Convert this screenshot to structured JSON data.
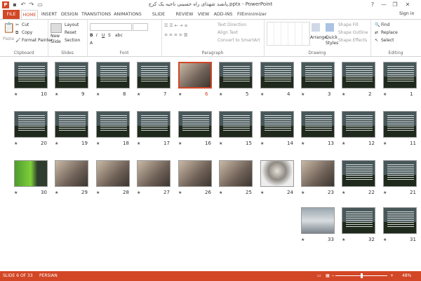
{
  "titlebar": {
    "title": "پانصد شهدای راه حسینی ناحیه یک کرج.pptx - PowerPoint",
    "app_icon": "P",
    "help": "?",
    "minimize": "—",
    "restore": "❐",
    "close": "✕"
  },
  "tabs": [
    "FILE",
    "HOME",
    "INSERT",
    "DESIGN",
    "TRANSITIONS",
    "ANIMATIONS",
    "SLIDE SHOW",
    "REVIEW",
    "VIEW",
    "ADD-INS",
    "FilEminimizer"
  ],
  "signin": "Sign in",
  "ribbon": {
    "clipboard": {
      "label": "Clipboard",
      "paste": "Paste",
      "cut": "Cut",
      "copy": "Copy",
      "format_painter": "Format Painter"
    },
    "slides": {
      "label": "Slides",
      "new_slide": "New",
      "new_slide2": "Slide",
      "layout": "Layout",
      "reset": "Reset",
      "section": "Section"
    },
    "font": {
      "label": "Font"
    },
    "paragraph": {
      "label": "Paragraph",
      "text_direction": "Text Direction",
      "align_text": "Align Text",
      "convert": "Convert to SmartArt"
    },
    "drawing": {
      "label": "Drawing",
      "arrange": "Arrange",
      "quick_styles": "Quick",
      "quick_styles2": "Styles",
      "shape_fill": "Shape Fill",
      "shape_outline": "Shape Outline",
      "shape_effects": "Shape Effects"
    },
    "editing": {
      "label": "Editing",
      "find": "Find",
      "replace": "Replace",
      "select": "Select"
    }
  },
  "slides": [
    {
      "n": "1",
      "kind": "text"
    },
    {
      "n": "2",
      "kind": "text"
    },
    {
      "n": "3",
      "kind": "text"
    },
    {
      "n": "4",
      "kind": "text"
    },
    {
      "n": "5",
      "kind": "text"
    },
    {
      "n": "6",
      "kind": "photo",
      "selected": true
    },
    {
      "n": "7",
      "kind": "text"
    },
    {
      "n": "8",
      "kind": "text"
    },
    {
      "n": "9",
      "kind": "text"
    },
    {
      "n": "10",
      "kind": "text"
    },
    {
      "n": "11",
      "kind": "text"
    },
    {
      "n": "12",
      "kind": "text"
    },
    {
      "n": "13",
      "kind": "text"
    },
    {
      "n": "14",
      "kind": "text"
    },
    {
      "n": "15",
      "kind": "text"
    },
    {
      "n": "16",
      "kind": "text"
    },
    {
      "n": "17",
      "kind": "text"
    },
    {
      "n": "18",
      "kind": "text"
    },
    {
      "n": "19",
      "kind": "text"
    },
    {
      "n": "20",
      "kind": "text"
    },
    {
      "n": "21",
      "kind": "text"
    },
    {
      "n": "22",
      "kind": "text"
    },
    {
      "n": "23",
      "kind": "photo"
    },
    {
      "n": "24",
      "kind": "portrait"
    },
    {
      "n": "25",
      "kind": "photo"
    },
    {
      "n": "26",
      "kind": "photo"
    },
    {
      "n": "27",
      "kind": "photo"
    },
    {
      "n": "28",
      "kind": "photo"
    },
    {
      "n": "29",
      "kind": "photo"
    },
    {
      "n": "30",
      "kind": "green"
    },
    {
      "n": "31",
      "kind": "text"
    },
    {
      "n": "32",
      "kind": "text"
    },
    {
      "n": "33",
      "kind": "laptop"
    }
  ],
  "star": "★",
  "status": {
    "slide": "SLIDE 6 OF 33",
    "language": "PERSIAN",
    "zoom": "48%",
    "zoom_minus": "−",
    "zoom_plus": "+"
  },
  "colors": {
    "accent": "#d24726"
  }
}
